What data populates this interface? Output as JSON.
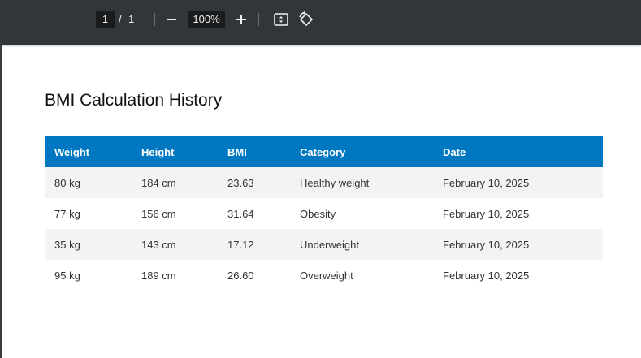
{
  "toolbar": {
    "current_page": "1",
    "separator": "/",
    "total_pages": "1",
    "zoom": "100%",
    "icons": [
      "zoom-out-icon",
      "zoom-in-icon",
      "fit-page-icon",
      "rotate-icon"
    ]
  },
  "document": {
    "title": "BMI Calculation History",
    "columns": [
      "Weight",
      "Height",
      "BMI",
      "Category",
      "Date"
    ],
    "rows": [
      [
        "80 kg",
        "184 cm",
        "23.63",
        "Healthy weight",
        "February 10, 2025"
      ],
      [
        "77 kg",
        "156 cm",
        "31.64",
        "Obesity",
        "February 10, 2025"
      ],
      [
        "35 kg",
        "143 cm",
        "17.12",
        "Underweight",
        "February 10, 2025"
      ],
      [
        "95 kg",
        "189 cm",
        "26.60",
        "Overweight",
        "February 10, 2025"
      ]
    ]
  },
  "colors": {
    "toolbar_bg": "#323639",
    "header_bg": "#0078c1",
    "stripe_bg": "#f3f3f3"
  }
}
